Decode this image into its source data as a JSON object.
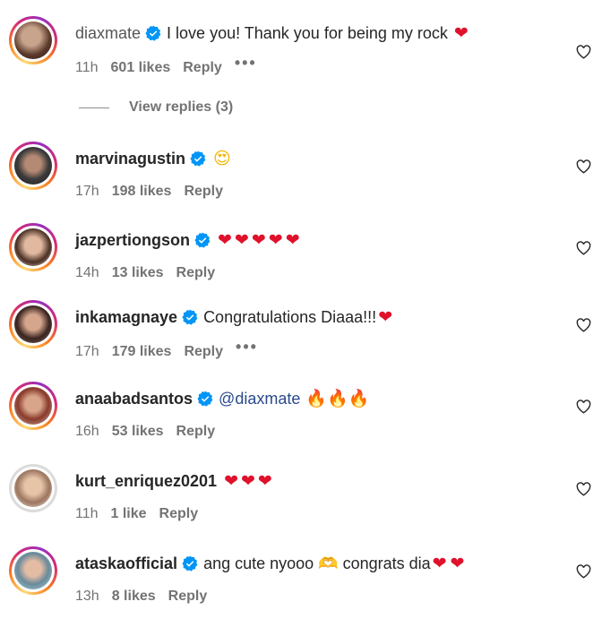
{
  "comments": [
    {
      "username": "diaxmate",
      "text": "I love you! Thank you for being my rock",
      "emojis": "❤",
      "time": "11h",
      "likes": "601 likes",
      "reply": "Reply",
      "more": "•••",
      "verified": true
    },
    {
      "username": "marvinagustin",
      "text": "",
      "emojis": "😍",
      "time": "17h",
      "likes": "198 likes",
      "reply": "Reply",
      "verified": true
    },
    {
      "username": "jazpertiongson",
      "text": "",
      "emojis": "❤❤❤❤❤",
      "time": "14h",
      "likes": "13 likes",
      "reply": "Reply",
      "verified": true
    },
    {
      "username": "inkamagnaye",
      "text": "Congratulations Diaaa!!!",
      "emojis": "❤",
      "time": "17h",
      "likes": "179 likes",
      "reply": "Reply",
      "more": "•••",
      "verified": true
    },
    {
      "username": "anaabadsantos",
      "text": "@diaxmate",
      "emojis": "🔥🔥🔥",
      "time": "16h",
      "likes": "53 likes",
      "reply": "Reply",
      "verified": true
    },
    {
      "username": "kurt_enriquez0201",
      "text": "",
      "emojis": "❤❤❤",
      "time": "11h",
      "likes": "1 like",
      "reply": "Reply",
      "verified": false
    },
    {
      "username": "ataskaofficial",
      "text": "ang cute nyooo 🫶 congrats dia",
      "emojis": "❤❤",
      "time": "13h",
      "likes": "8 likes",
      "reply": "Reply",
      "verified": true
    }
  ],
  "view_replies": "View replies (3)",
  "colors": {
    "heart": "#e0112b",
    "verified": "#0095f6",
    "meta": "#737373",
    "mention": "#2b4a8c"
  }
}
